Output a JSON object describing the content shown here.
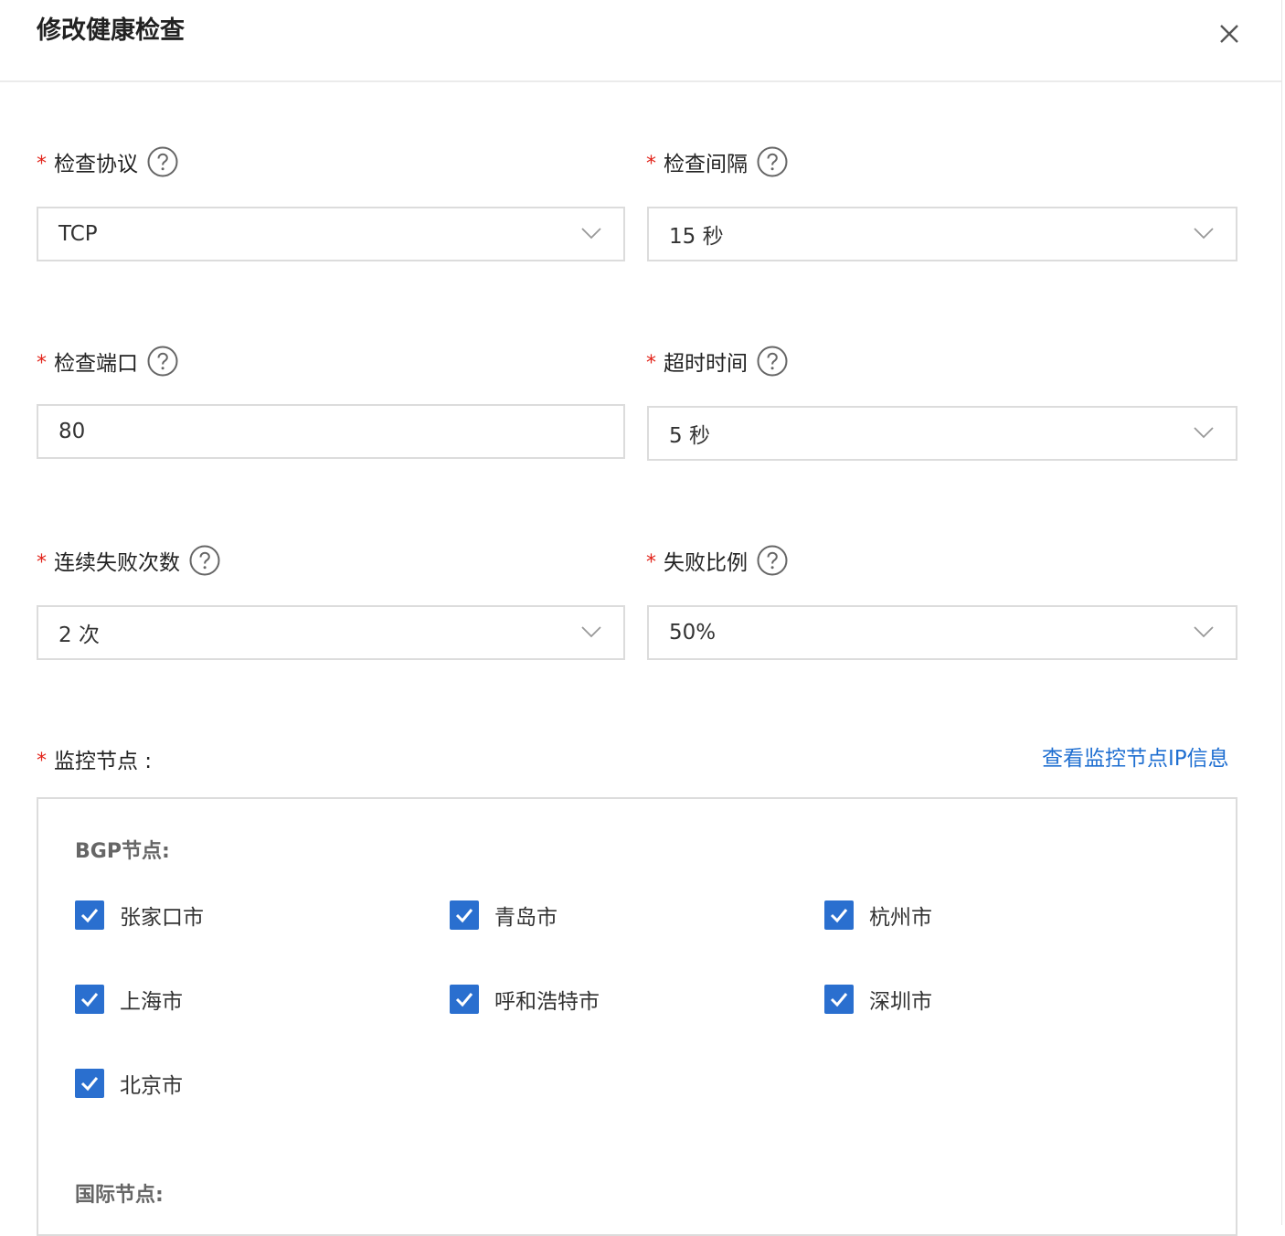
{
  "dialog": {
    "title": "修改健康检查"
  },
  "form": {
    "protocol": {
      "label": "检查协议",
      "value": "TCP"
    },
    "interval": {
      "label": "检查间隔",
      "value": "15 秒"
    },
    "port": {
      "label": "检查端口",
      "value": "80"
    },
    "timeout": {
      "label": "超时时间",
      "value": "5 秒"
    },
    "fail_count": {
      "label": "连续失败次数",
      "value": "2 次"
    },
    "fail_ratio": {
      "label": "失败比例",
      "value": "50%"
    }
  },
  "monitor": {
    "label": "监控节点 :",
    "link": "查看监控节点IP信息",
    "bgp_title": "BGP节点:",
    "bgp_nodes": [
      "张家口市",
      "青岛市",
      "杭州市",
      "上海市",
      "呼和浩特市",
      "深圳市",
      "北京市"
    ],
    "intl_title": "国际节点:"
  },
  "colors": {
    "accent": "#2a6fcf",
    "link": "#1f6fd1",
    "required": "#e2231a"
  }
}
